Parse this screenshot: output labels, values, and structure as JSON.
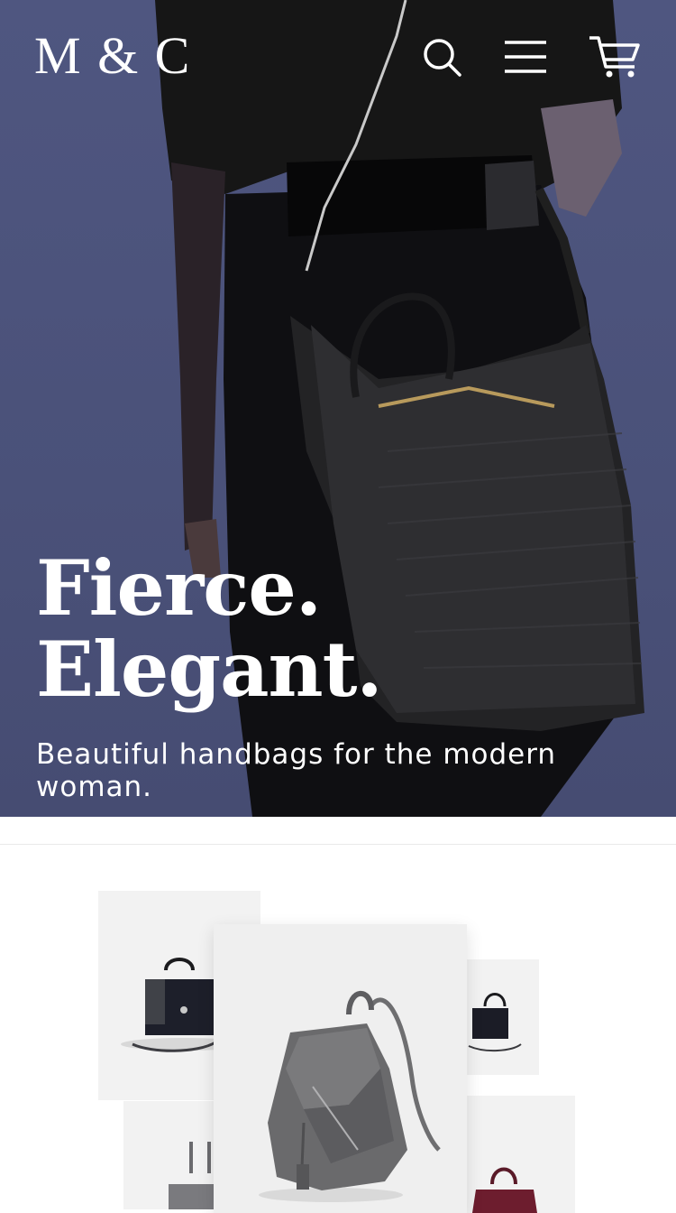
{
  "header": {
    "logo": "M & C",
    "icons": [
      "search-icon",
      "menu-icon",
      "cart-icon"
    ]
  },
  "hero": {
    "headline_line1": "Fierce.",
    "headline_line2": "Elegant.",
    "tagline": "Beautiful handbags for the modern woman."
  },
  "colors": {
    "hero_bg": "#4f5680",
    "text": "#ffffff",
    "card_bg": "#f2f2f2"
  }
}
